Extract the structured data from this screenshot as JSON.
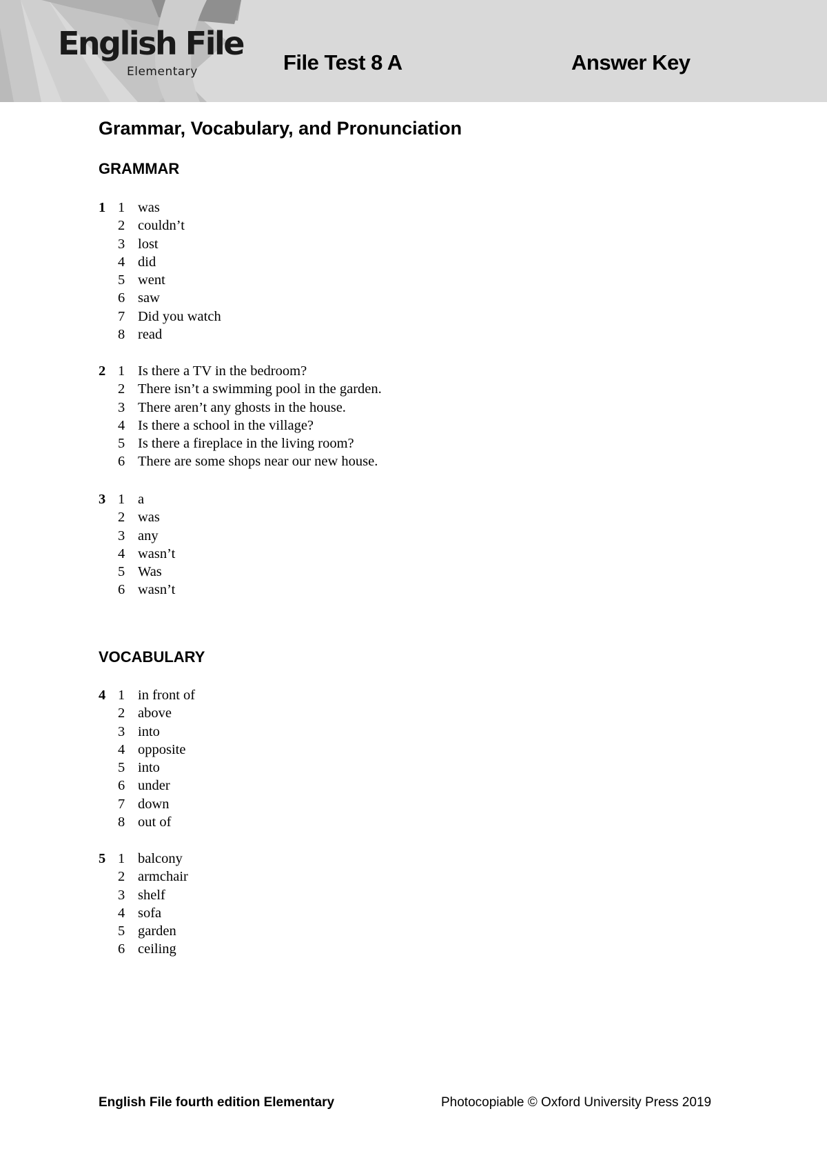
{
  "header": {
    "logo_title": "English File",
    "logo_subtitle": "Elementary",
    "test_title": "File Test 8 A",
    "doc_type": "Answer Key",
    "background_color": "#d9d9d9"
  },
  "main_heading": "Grammar, Vocabulary, and Pronunciation",
  "sections": {
    "grammar": {
      "heading": "GRAMMAR",
      "exercises": [
        {
          "number": "1",
          "items": [
            "was",
            "couldn’t",
            "lost",
            "did",
            "went",
            "saw",
            "Did you watch",
            "read"
          ]
        },
        {
          "number": "2",
          "items": [
            "Is there a TV in the bedroom?",
            "There isn’t a swimming pool in the garden.",
            "There aren’t any ghosts in the house.",
            "Is there a school in the village?",
            "Is there a fireplace in the living room?",
            "There are some shops near our new house."
          ]
        },
        {
          "number": "3",
          "items": [
            "a",
            "was",
            "any",
            "wasn’t",
            "Was",
            "wasn’t"
          ]
        }
      ]
    },
    "vocabulary": {
      "heading": "VOCABULARY",
      "exercises": [
        {
          "number": "4",
          "items": [
            "in front of",
            "above",
            "into",
            "opposite",
            "into",
            "under",
            "down",
            "out of"
          ]
        },
        {
          "number": "5",
          "items": [
            "balcony",
            "armchair",
            "shelf",
            "sofa",
            "garden",
            "ceiling"
          ]
        }
      ]
    }
  },
  "footer": {
    "left": "English File fourth edition Elementary",
    "right": "Photocopiable © Oxford University Press 2019"
  }
}
